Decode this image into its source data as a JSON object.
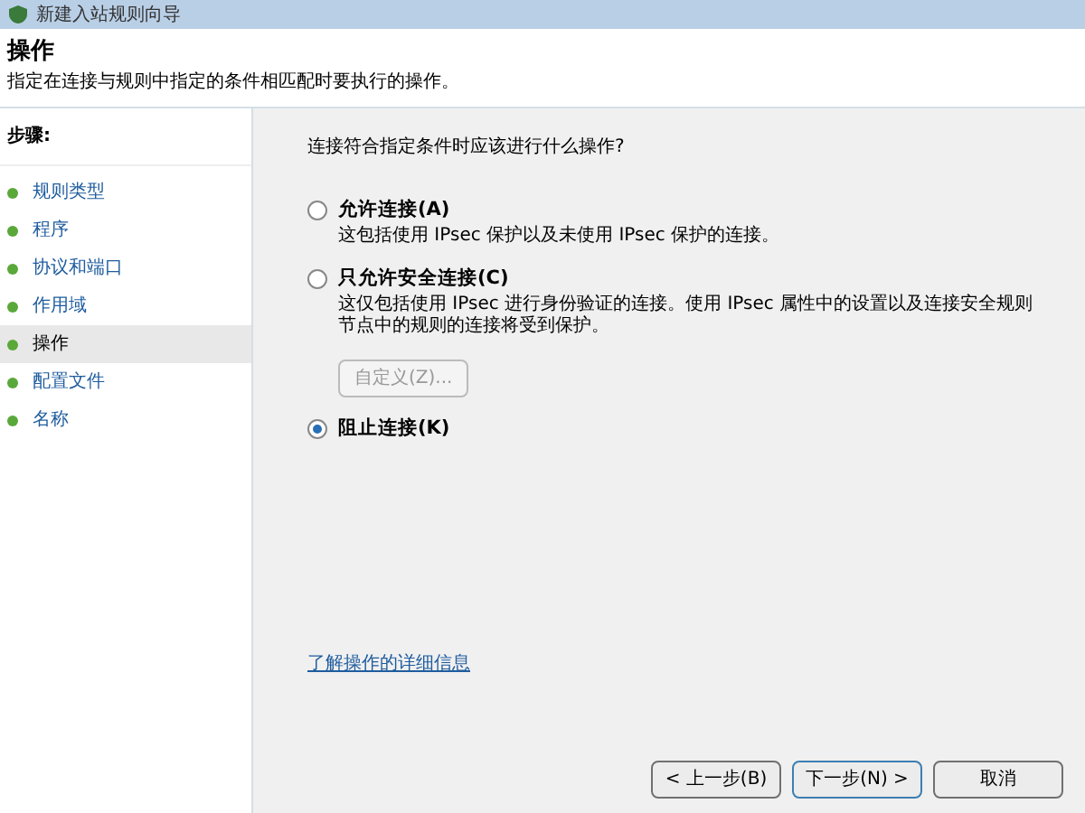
{
  "window": {
    "title": "新建入站规则向导"
  },
  "header": {
    "title": "操作",
    "subtitle": "指定在连接与规则中指定的条件相匹配时要执行的操作。"
  },
  "steps": {
    "label": "步骤:",
    "items": [
      {
        "label": "规则类型",
        "selected": false
      },
      {
        "label": "程序",
        "selected": false
      },
      {
        "label": "协议和端口",
        "selected": false
      },
      {
        "label": "作用域",
        "selected": false
      },
      {
        "label": "操作",
        "selected": true
      },
      {
        "label": "配置文件",
        "selected": false
      },
      {
        "label": "名称",
        "selected": false
      }
    ]
  },
  "question": "连接符合指定条件时应该进行什么操作?",
  "options": [
    {
      "label": "允许连接(A)",
      "description": "这包括使用 IPsec 保护以及未使用 IPsec 保护的连接。",
      "selected": false
    },
    {
      "label": "只允许安全连接(C)",
      "description": "这仅包括使用 IPsec 进行身份验证的连接。使用 IPsec 属性中的设置以及连接安全规则节点中的规则的连接将受到保护。",
      "selected": false,
      "button": {
        "label": "自定义(Z)...",
        "disabled": true
      }
    },
    {
      "label": "阻止连接(K)",
      "selected": true
    }
  ],
  "link": "了解操作的详细信息",
  "buttons": [
    "< 上一步(B)",
    "下一步(N) >",
    "取消"
  ]
}
